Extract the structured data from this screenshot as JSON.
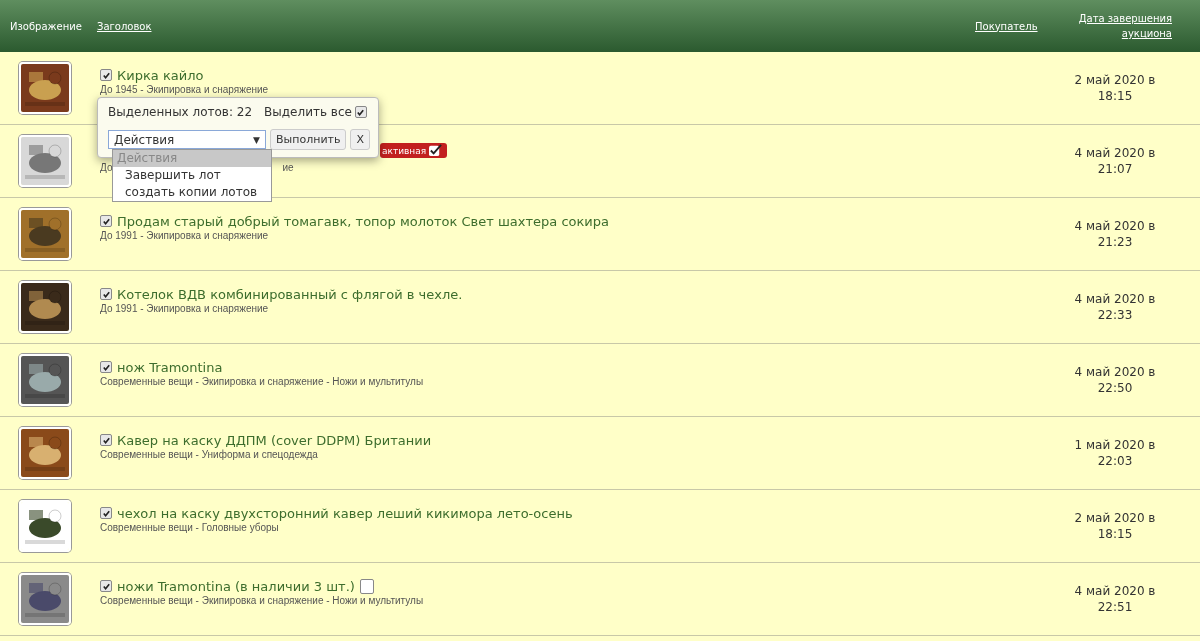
{
  "columns": [
    {
      "label": "Изображение",
      "link": false
    },
    {
      "label": "Заголовок",
      "link": true
    },
    {
      "label": "Покупатель",
      "link": true
    },
    {
      "label": "Дата завершения аукциона",
      "link": true
    }
  ],
  "rows": [
    {
      "checked": true,
      "title": "Кирка кайло",
      "subtitle": "До 1945 - Экипировка и снаряжение",
      "date": "2 май 2020 в",
      "time": "18:15"
    },
    {
      "subtitle_start": "До",
      "subtitle_end": "ие",
      "badge": "активная",
      "date": "4 май 2020 в",
      "time": "21:07"
    },
    {
      "checked": true,
      "title": "Продам старый добрый томагавк, топор молоток Свет шахтера сокира",
      "subtitle": "До 1991 - Экипировка и снаряжение",
      "date": "4 май 2020 в",
      "time": "21:23"
    },
    {
      "checked": true,
      "title": "Котелок ВДВ комбинированный с флягой в чехле.",
      "subtitle": "До 1991 - Экипировка и снаряжение",
      "date": "4 май 2020 в",
      "time": "22:33"
    },
    {
      "checked": true,
      "title": "нож Tramontina",
      "subtitle": "Современные вещи - Экипировка и снаряжение - Ножи и мультитулы",
      "date": "4 май 2020 в",
      "time": "22:50"
    },
    {
      "checked": true,
      "title": "Кавер на каску ДДПМ (cover DDPM) Британии",
      "subtitle": "Современные вещи - Униформа и спецодежда",
      "date": "1 май 2020 в",
      "time": "22:03"
    },
    {
      "checked": true,
      "title": "чехол на каску двухсторонний кавер леший кикимора лето-осень",
      "subtitle": "Современные вещи - Головные уборы",
      "date": "2 май 2020 в",
      "time": "18:15"
    },
    {
      "checked": true,
      "title": "ножи Tramontina (в наличии 3 шт.)",
      "note_checked": false,
      "subtitle": "Современные вещи - Экипировка и снаряжение - Ножи и мультитулы",
      "date": "4 май 2020 в",
      "time": "22:51"
    }
  ],
  "popup": {
    "selected_count": "Выделенных лотов: 22",
    "select_all": "Выделить все",
    "select_all_checked": true,
    "action": "Действия",
    "caret": "▼",
    "run_button": "Выполнить",
    "close_button": "X",
    "options": [
      {
        "label": "Действия",
        "selected": true
      },
      {
        "label": "Завершить лот",
        "selected": false
      },
      {
        "label": "создать копии лотов",
        "selected": false
      }
    ]
  }
}
